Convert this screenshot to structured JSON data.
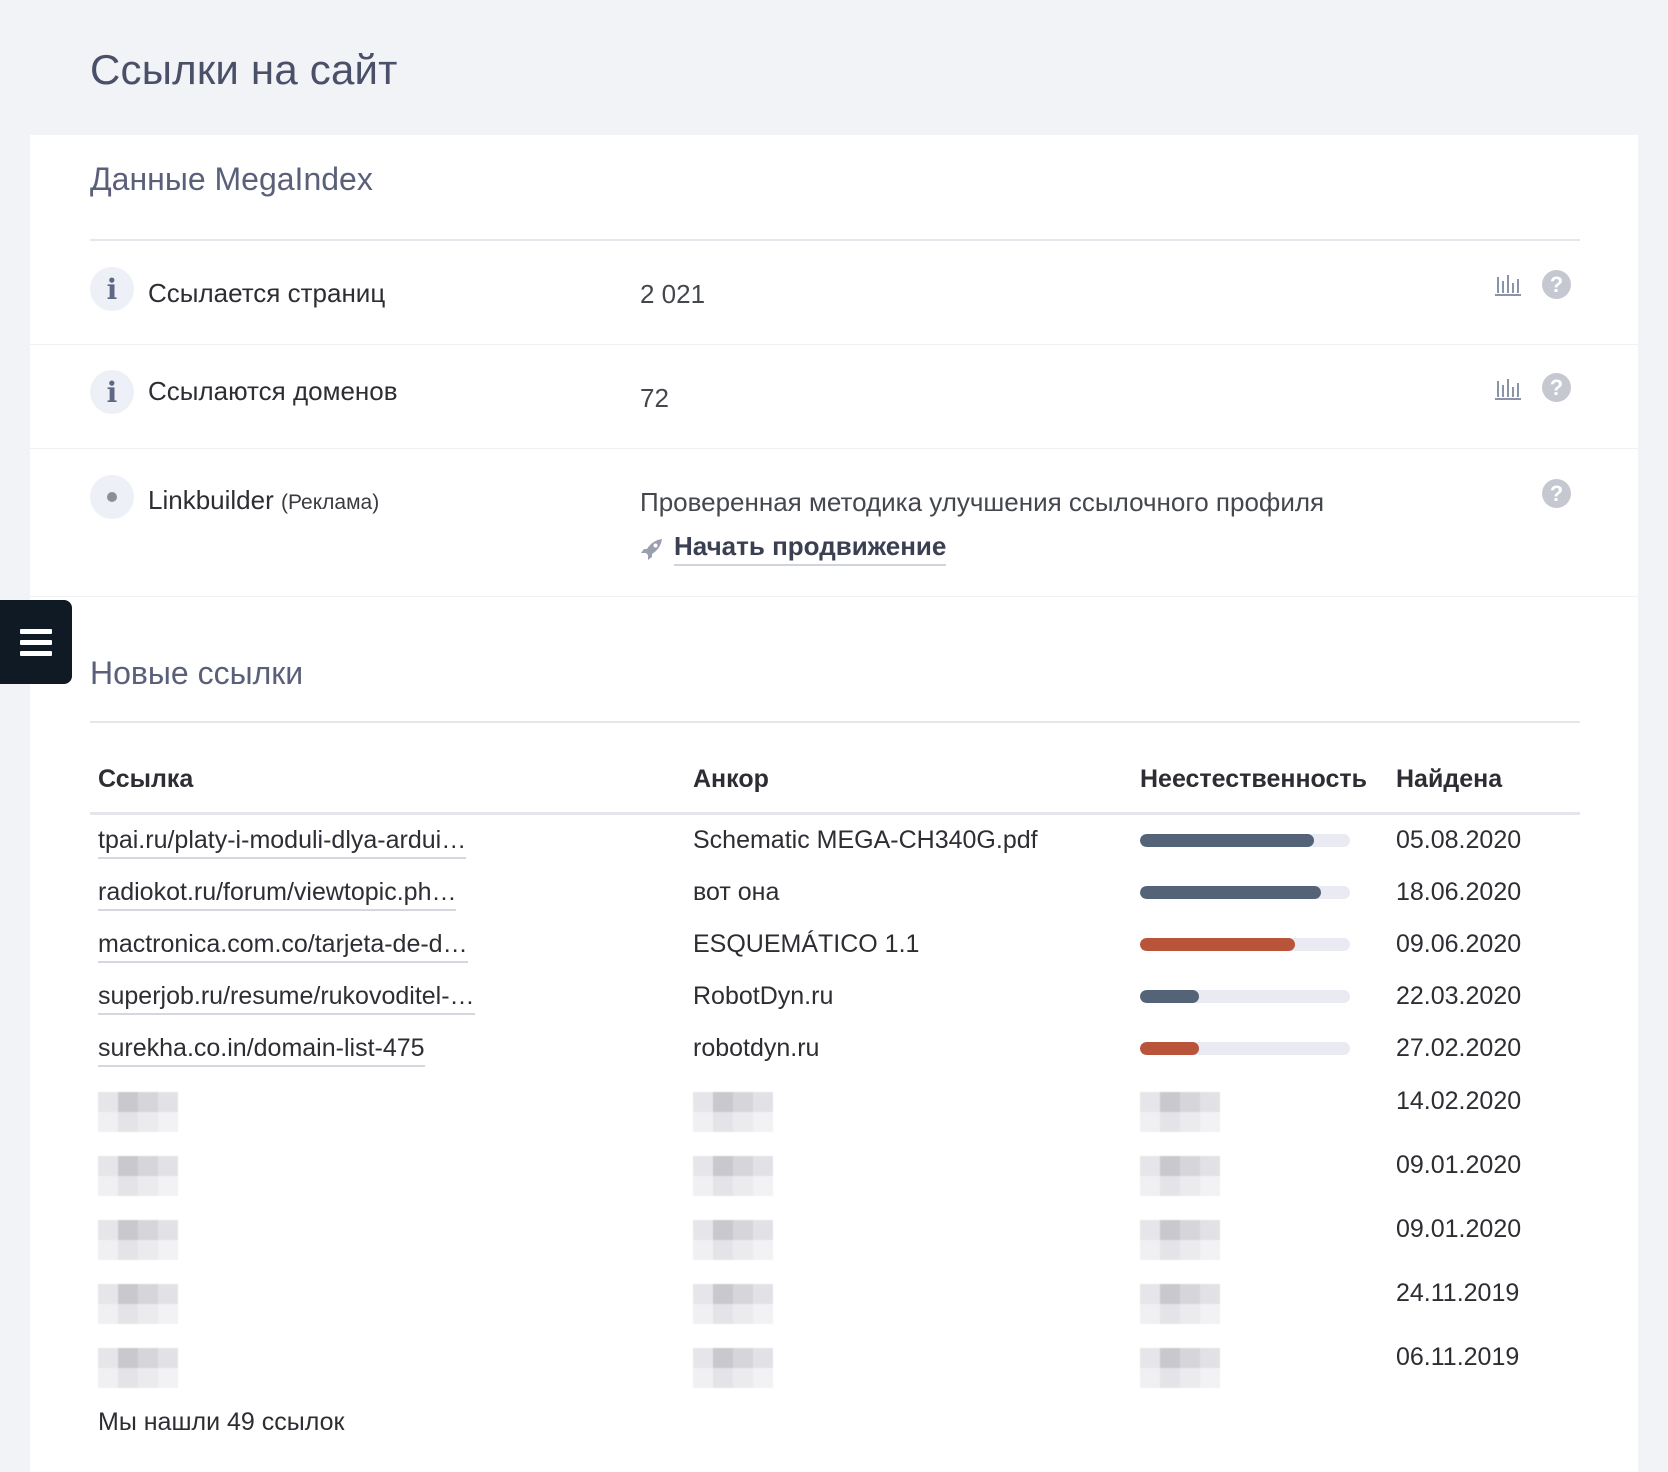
{
  "page_title": "Ссылки на сайт",
  "megaindex": {
    "title": "Данные MegaIndex",
    "rows": [
      {
        "icon": "info-icon",
        "label": "Ссылается страниц",
        "value": "2 021"
      },
      {
        "icon": "info-icon",
        "label": "Ссылаются доменов",
        "value": "72"
      }
    ],
    "linkbuilder": {
      "label": "Linkbuilder",
      "ad_note": "(Реклама)",
      "description": "Проверенная методика улучшения ссылочного профиля",
      "action": "Начать продвижение"
    }
  },
  "new_links": {
    "title": "Новые ссылки",
    "columns": {
      "link": "Ссылка",
      "anchor": "Анкор",
      "unnatural": "Неестественность",
      "found": "Найдена"
    },
    "rows": [
      {
        "link": "tpai.ru/platy-i-moduli-dlya-ardui…",
        "anchor": "Schematic MEGA-CH340G.pdf",
        "unnatural": 0.83,
        "bar_color": "#546378",
        "found": "05.08.2020"
      },
      {
        "link": "radiokot.ru/forum/viewtopic.ph…",
        "anchor": "вот она",
        "unnatural": 0.86,
        "bar_color": "#546378",
        "found": "18.06.2020"
      },
      {
        "link": "mactronica.com.co/tarjeta-de-d…",
        "anchor": "ESQUEMÁTICO 1.1",
        "unnatural": 0.74,
        "bar_color": "#b9533a",
        "found": "09.06.2020"
      },
      {
        "link": "superjob.ru/resume/rukovoditel-…",
        "anchor": "RobotDyn.ru",
        "unnatural": 0.28,
        "bar_color": "#546378",
        "found": "22.03.2020"
      },
      {
        "link": "surekha.co.in/domain-list-475",
        "anchor": "robotdyn.ru",
        "unnatural": 0.28,
        "bar_color": "#b9533a",
        "found": "27.02.2020"
      }
    ],
    "hidden_rows": [
      {
        "found": "14.02.2020"
      },
      {
        "found": "09.01.2020"
      },
      {
        "found": "09.01.2020"
      },
      {
        "found": "24.11.2019"
      },
      {
        "found": "06.11.2019"
      }
    ],
    "summary": "Мы нашли 49 ссылок"
  }
}
